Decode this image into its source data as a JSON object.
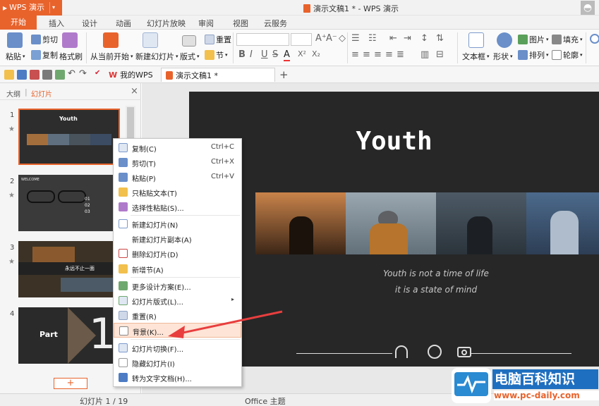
{
  "app": {
    "name": "WPS 演示",
    "window_title": "演示文稿1 * - WPS 演示"
  },
  "menu_tabs": [
    "开始",
    "插入",
    "设计",
    "动画",
    "幻灯片放映",
    "审阅",
    "视图",
    "云服务"
  ],
  "ribbon": {
    "paste": "粘贴",
    "cut": "剪切",
    "copy": "复制",
    "format_painter": "格式刷",
    "from_current": "从当前开始",
    "new_slide": "新建幻灯片",
    "layout": "版式",
    "reset": "重置",
    "section": "节",
    "bold": "B",
    "italic": "I",
    "underline": "U",
    "strike": "S",
    "fontcolor": "A",
    "superscript": "X²",
    "subscript": "X₂",
    "textbox": "文本框",
    "shape": "形状",
    "picture": "图片",
    "fill": "填充",
    "arrange": "排列",
    "outline": "轮廓"
  },
  "quick_access": {
    "tab_mywps": "我的WPS",
    "tab_doc": "演示文稿1 *",
    "new_tab": "+"
  },
  "panel": {
    "tab_outline": "大纲",
    "tab_slides": "幻灯片",
    "close": "×",
    "add_slide": "+",
    "slide_numbers": [
      "1",
      "2",
      "3",
      "4"
    ],
    "thumb1_title": "Youth",
    "thumb2_title": "WELCOME",
    "thumb2_items": [
      "01",
      "02",
      "03"
    ],
    "thumb3_text": "永远不止一面",
    "thumb4_text": "Part",
    "thumb4_num": "1"
  },
  "slide": {
    "title": "Youth",
    "line1": "Youth is not a time of life",
    "line2": "it is a state of mind"
  },
  "context_menu": [
    {
      "label": "复制(C)",
      "shortcut": "Ctrl+C",
      "icon": "copy-icon"
    },
    {
      "label": "剪切(T)",
      "shortcut": "Ctrl+X",
      "icon": "scissors-icon"
    },
    {
      "label": "粘贴(P)",
      "shortcut": "Ctrl+V",
      "icon": "paste-icon"
    },
    {
      "label": "只粘贴文本(T)",
      "shortcut": "",
      "icon": "paste-text-icon"
    },
    {
      "label": "选择性粘贴(S)...",
      "shortcut": "",
      "icon": "paste-special-icon"
    },
    {
      "label": "新建幻灯片(N)",
      "shortcut": "",
      "icon": "new-slide-icon"
    },
    {
      "label": "新建幻灯片副本(A)",
      "shortcut": "",
      "icon": ""
    },
    {
      "label": "删除幻灯片(D)",
      "shortcut": "",
      "icon": "delete-slide-icon"
    },
    {
      "label": "新增节(A)",
      "shortcut": "",
      "icon": "section-icon"
    },
    {
      "label": "更多设计方案(E)...",
      "shortcut": "",
      "icon": "design-icon"
    },
    {
      "label": "幻灯片版式(L)...",
      "shortcut": "",
      "icon": "layout-icon"
    },
    {
      "label": "重置(R)",
      "shortcut": "",
      "icon": "reset-icon"
    },
    {
      "label": "背景(K)...",
      "shortcut": "",
      "icon": "background-icon"
    },
    {
      "label": "幻灯片切换(F)...",
      "shortcut": "",
      "icon": "transition-icon"
    },
    {
      "label": "隐藏幻灯片(I)",
      "shortcut": "",
      "icon": "hide-slide-icon"
    },
    {
      "label": "转为文字文档(H)...",
      "shortcut": "",
      "icon": "convert-doc-icon"
    }
  ],
  "status": {
    "slide_count": "幻灯片 1 / 19",
    "theme": "Office 主题"
  },
  "watermark": {
    "name": "电脑百科知识",
    "url": "www.pc-daily.com"
  },
  "colors": {
    "accent": "#e8632c",
    "slide_bg": "#272727",
    "highlight": "#fde4d6",
    "arrow": "#e83e3e"
  }
}
